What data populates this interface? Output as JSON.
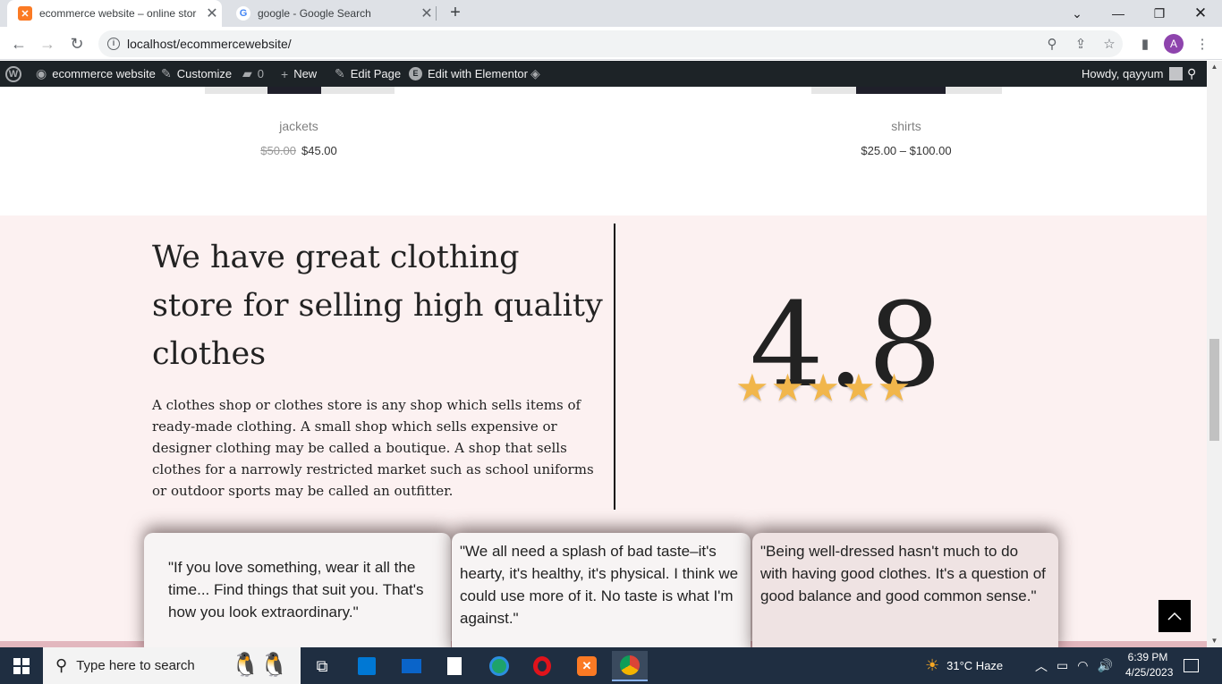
{
  "browser": {
    "tabs": [
      {
        "title": "ecommerce website – online stor",
        "favicon": "xampp-icon"
      },
      {
        "title": "google - Google Search",
        "favicon": "google-icon"
      }
    ],
    "url": "localhost/ecommercewebsite/",
    "profile_initial": "A"
  },
  "wpbar": {
    "site_name": "ecommerce website",
    "customize": "Customize",
    "comments_count": "0",
    "new": "New",
    "edit_page": "Edit Page",
    "elementor": "Edit with Elementor",
    "howdy": "Howdy, qayyum"
  },
  "products": [
    {
      "name": "jackets",
      "old_price": "$50.00",
      "price": "$45.00"
    },
    {
      "name": "shirts",
      "price": "$25.00 – $100.00"
    }
  ],
  "about": {
    "heading": "We have great clothing store for selling high quality clothes",
    "body": "A clothes shop or clothes store is any shop which sells items of ready-made clothing. A small shop which sells expensive or designer clothing may be called a boutique. A shop that sells clothes for a narrowly restricted market such as school uniforms or outdoor sports may be called an outfitter.",
    "rating": "4.8",
    "stars": 5
  },
  "quotes": [
    "\"If you love something, wear it all the time... Find things that suit you. That's how you look extraordinary.\"",
    "\"We all need a splash of bad taste–it's hearty, it's healthy, it's physical. I think we could use more of it. No taste is what I'm against.\"",
    "\"Being well-dressed hasn't much to do with having good clothes. It's a question of good balance and good common sense.\""
  ],
  "taskbar": {
    "search_placeholder": "Type here to search",
    "weather": "31°C  Haze",
    "time": "6:39 PM",
    "date": "4/25/2023"
  }
}
